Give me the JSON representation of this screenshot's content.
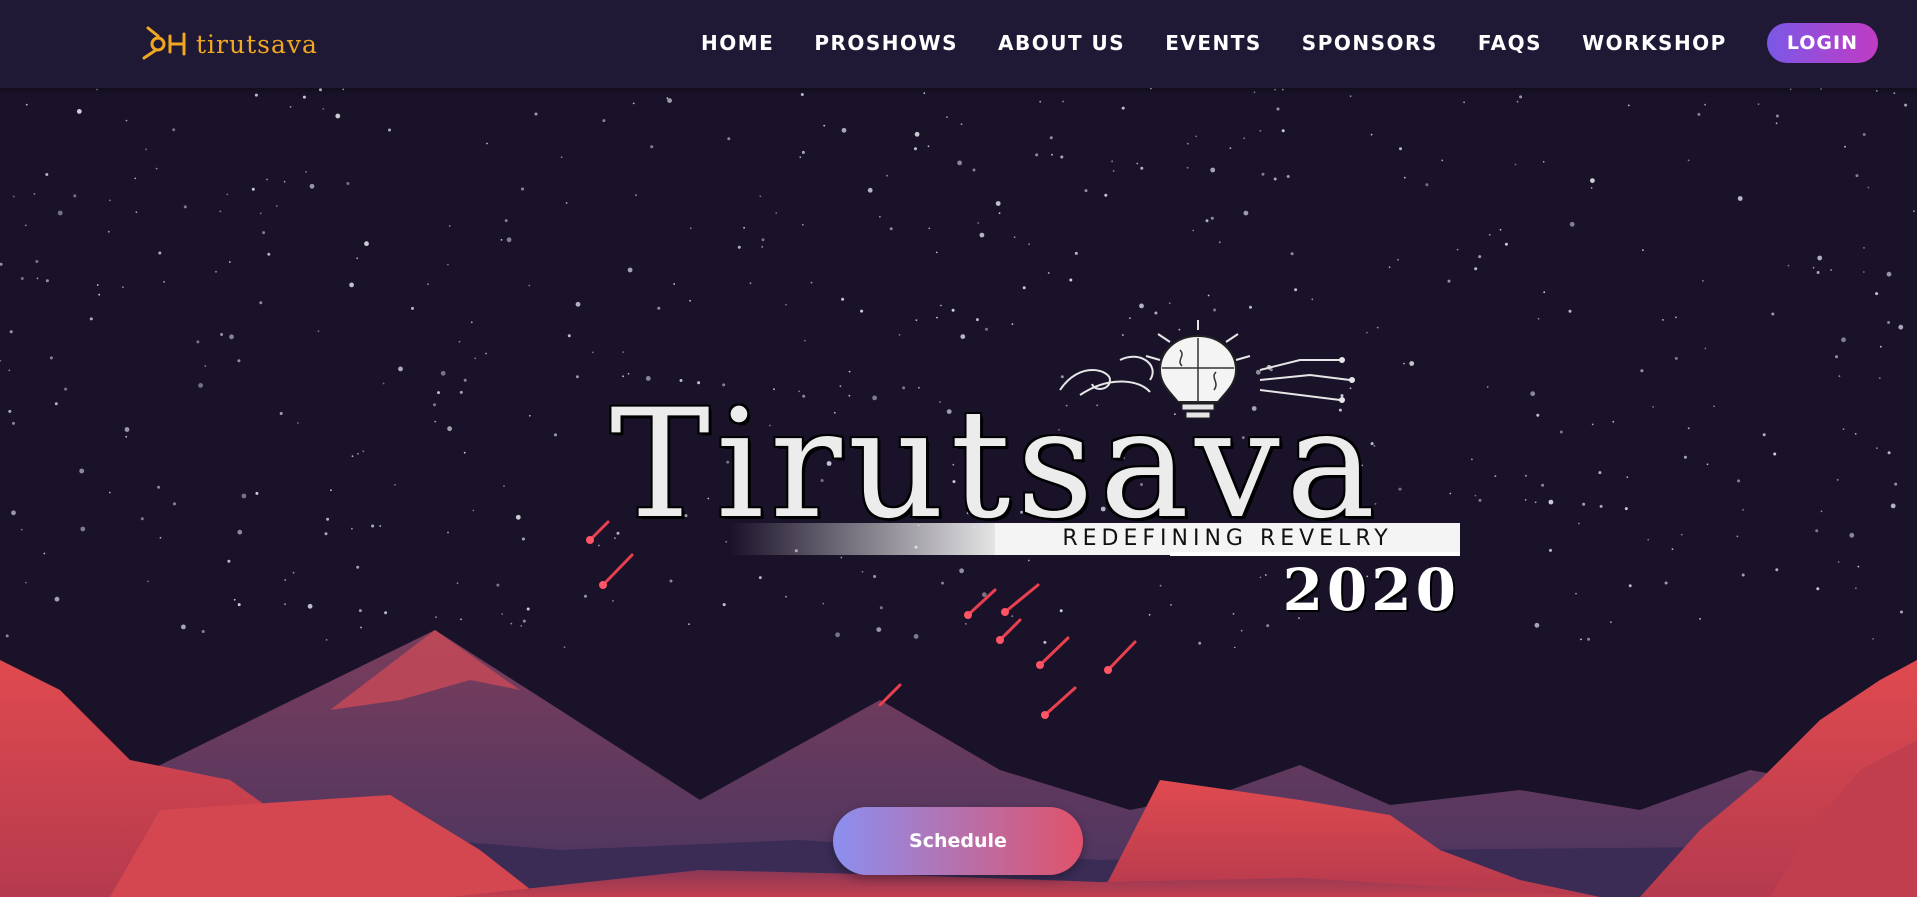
{
  "nav": {
    "brand": "tirutsava",
    "links": [
      "HOME",
      "PROSHOWS",
      "ABOUT US",
      "EVENTS",
      "SPONSORS",
      "FAQS",
      "WORKSHOP"
    ],
    "login": "LOGIN"
  },
  "hero": {
    "title": "Tirutsava",
    "tagline": "REDEFINING REVELRY",
    "year": "2020"
  },
  "cta": {
    "schedule": "Schedule"
  },
  "colors": {
    "background": "#1a1229",
    "navbar": "#1f1935",
    "brand": "#f0a820",
    "mountain_front": "#d8444e",
    "mountain_back": "#5a3a64"
  }
}
